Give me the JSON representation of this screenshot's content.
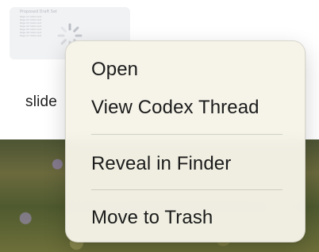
{
  "desktop": {
    "file_label": "slide",
    "thumbnail": {
      "title": "Proposed Draft Set",
      "lines": [
        "Page 01 Slide text",
        "Page 02 Slide text",
        "Page 03 Slide text",
        "Page 04 Slide text",
        "Page 05 Slide text",
        "Page 06 Slide text",
        "Page 07 Slide text"
      ]
    },
    "spinner_icon": "loading-spinner-icon"
  },
  "context_menu": {
    "items": [
      {
        "label": "Open"
      },
      {
        "label": "View Codex Thread"
      },
      {
        "label": "Reveal in Finder"
      },
      {
        "label": "Move to Trash"
      }
    ]
  },
  "colors": {
    "menu_background": "#f6f4e8",
    "menu_text": "#1b1b1b",
    "separator": "#d7d5cc"
  }
}
